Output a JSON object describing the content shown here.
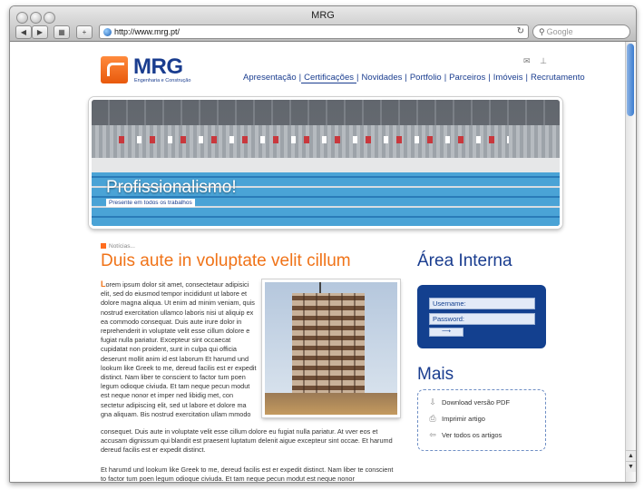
{
  "window": {
    "title": "MRG"
  },
  "toolbar": {
    "back": "◀",
    "forward": "▶",
    "bookmarks": "▦",
    "add": "+",
    "url": "http://www.mrg.pt/",
    "search_placeholder": "Google"
  },
  "site": {
    "logo_text": "MRG",
    "logo_sub": "Engenharia e Construção",
    "nav": [
      "Apresentação",
      "Certificações",
      "Novidades",
      "Portfolio",
      "Parceiros",
      "Imóveis",
      "Recrutamento"
    ],
    "nav_active": "Certificações"
  },
  "hero": {
    "title": "Profissionalismo!",
    "subtitle": "Presente em todos os trabalhos"
  },
  "article": {
    "crumb": "Notícias...",
    "title": "Duis aute in voluptate velit cillum",
    "drop_letter": "L",
    "para1_narrow": "orem ipsum dolor sit amet, consectetaur adipisici elit, sed do eiusmod tempor incididunt ut labore et dolore magna aliqua. Ut enim ad minim veniam, quis nostrud exercitation ullamco laboris nisi ut aliquip ex ea commodo consequat. Duis aute irure dolor in reprehenderit in voluptate velit esse cillum dolore e fugiat nulla pariatur. Excepteur sint occaecat cupidatat non proident, sunt in culpa qui officia deserunt mollit anim id est laborum Et harumd und lookum like Greek to me, dereud facilis est er expedit distinct. Nam liber te conscient to factor tum poen legum odioque civiuda. Et tam neque pecun modut est neque nonor et imper ned libidig met, con sectetur adipiscing elit, sed ut labore et dolore ma gna aliquam. Bis nostrud exercitation ullam mmodo",
    "para1_wide": "consequet. Duis aute in voluptate velit esse cillum dolore eu fugiat nulla pariatur. At vver eos et accusam dignissum qui blandit est praesent luptatum delenit aigue excepteur sint occae. Et harumd dereud facilis est er expedit distinct.",
    "para2": "Et harumd und lookum like Greek to me, dereud facilis est er expedit distinct. Nam liber te conscient to factor tum poen legum odioque civiuda. Et tam neque pecun modut est neque nonor"
  },
  "sidebar": {
    "area_title": "Área Interna",
    "username_label": "Username:",
    "password_label": "Password:",
    "mais_title": "Mais",
    "links": [
      "Download versão PDF",
      "Imprimir artigo",
      "Ver todos os artigos"
    ]
  },
  "icons": {
    "mail": "mail-icon",
    "sitemap": "sitemap-icon",
    "pdf": "download-icon",
    "print": "print-icon",
    "back": "back-arrow-icon"
  },
  "colors": {
    "brand_blue": "#1a3d8f",
    "accent_orange": "#f07318"
  }
}
